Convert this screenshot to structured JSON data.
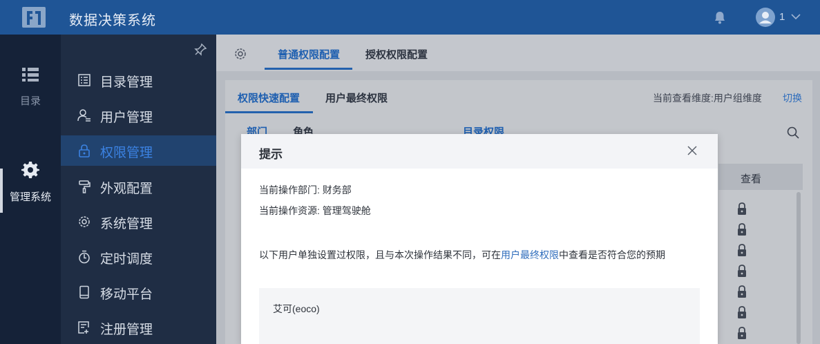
{
  "app": {
    "title": "数据决策系统",
    "user_name": "1"
  },
  "rail": [
    {
      "label": "目录",
      "icon": "list-icon"
    },
    {
      "label": "管理系统",
      "icon": "gear-icon",
      "active": true
    }
  ],
  "menu": [
    {
      "label": "目录管理",
      "icon": "directory-icon"
    },
    {
      "label": "用户管理",
      "icon": "user-icon"
    },
    {
      "label": "权限管理",
      "icon": "lock-icon",
      "active": true
    },
    {
      "label": "外观配置",
      "icon": "paint-roller-icon"
    },
    {
      "label": "系统管理",
      "icon": "settings-icon"
    },
    {
      "label": "定时调度",
      "icon": "timer-icon"
    },
    {
      "label": "移动平台",
      "icon": "mobile-icon"
    },
    {
      "label": "注册管理",
      "icon": "register-icon"
    }
  ],
  "tabs": {
    "normal": "普通权限配置",
    "grant": "授权权限配置"
  },
  "subtabs": {
    "quick": "权限快速配置",
    "final": "用户最终权限"
  },
  "dimension": {
    "label": "当前查看维度:用户组维度",
    "switch": "切换"
  },
  "left_pane": {
    "tab_dept": "部门",
    "tab_role": "角色"
  },
  "right_pane": {
    "title": "目录权限",
    "col_view": "查看"
  },
  "dialog": {
    "title": "提示",
    "dept_line": "当前操作部门: 财务部",
    "resource_line": "当前操作资源: 管理驾驶舱",
    "msg_before": "以下用户单独设置过权限，且与本次操作结果不同，可在",
    "msg_link": "用户最终权限",
    "msg_after": "中查看是否符合您的预期",
    "users": [
      "艾可(eoco)"
    ]
  },
  "colors": {
    "topbar": "#1f5596",
    "sidebar": "#1f2d44",
    "rail": "#152238",
    "accent": "#1e5fb0",
    "link": "#2f6dbc"
  }
}
